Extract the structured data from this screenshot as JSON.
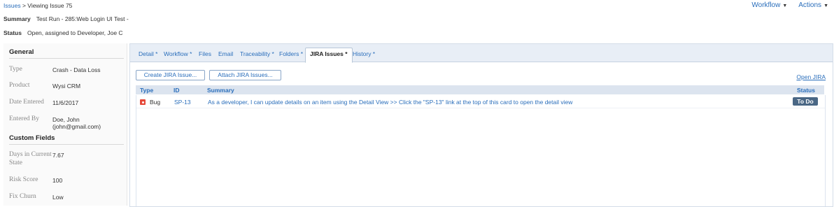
{
  "breadcrumb": {
    "link": "Issues",
    "separator": ">",
    "current": "Viewing Issue 75"
  },
  "header_actions": [
    {
      "label": "Workflow"
    },
    {
      "label": "Actions"
    }
  ],
  "summary": {
    "label": "Summary",
    "value": "Test Run - 285:Web Login UI Test -"
  },
  "status": {
    "label": "Status",
    "value": "Open, assigned to Developer, Joe C"
  },
  "general": {
    "title": "General",
    "fields": [
      {
        "label": "Type",
        "value": "Crash - Data Loss"
      },
      {
        "label": "Product",
        "value": "Wysi CRM"
      },
      {
        "label": "Date Entered",
        "value": "11/6/2017"
      },
      {
        "label": "Entered By",
        "value": "Doe, John (john@gmail.com)"
      }
    ]
  },
  "custom_fields": {
    "title": "Custom Fields",
    "fields": [
      {
        "label": "Days in Current State",
        "value": "7.67"
      },
      {
        "label": "Risk Score",
        "value": "100"
      },
      {
        "label": "Fix Churn",
        "value": "Low"
      }
    ]
  },
  "tabs": [
    {
      "label": "Detail *"
    },
    {
      "label": "Workflow *"
    },
    {
      "label": "Files"
    },
    {
      "label": "Email"
    },
    {
      "label": "Traceability *"
    },
    {
      "label": "Folders *"
    },
    {
      "label": "JIRA Issues *",
      "active": true
    },
    {
      "label": "History *"
    }
  ],
  "buttons": {
    "create": "Create JIRA Issue...",
    "attach": "Attach JIRA Issues...",
    "open": "Open JIRA"
  },
  "table": {
    "columns": [
      "Type",
      "ID",
      "Summary",
      "Status"
    ],
    "rows": [
      {
        "type": "Bug",
        "id": "SP-13",
        "summary": "As a developer, I can update details on an item using the Detail View >> Click the \"SP-13\" link at the top of this card to open the detail view",
        "status": "To Do"
      }
    ]
  },
  "colors": {
    "link": "#2a6ebb",
    "status_badge": "#4a6785",
    "bug_icon": "#e5493a",
    "tabbar": "#e8eef6"
  }
}
